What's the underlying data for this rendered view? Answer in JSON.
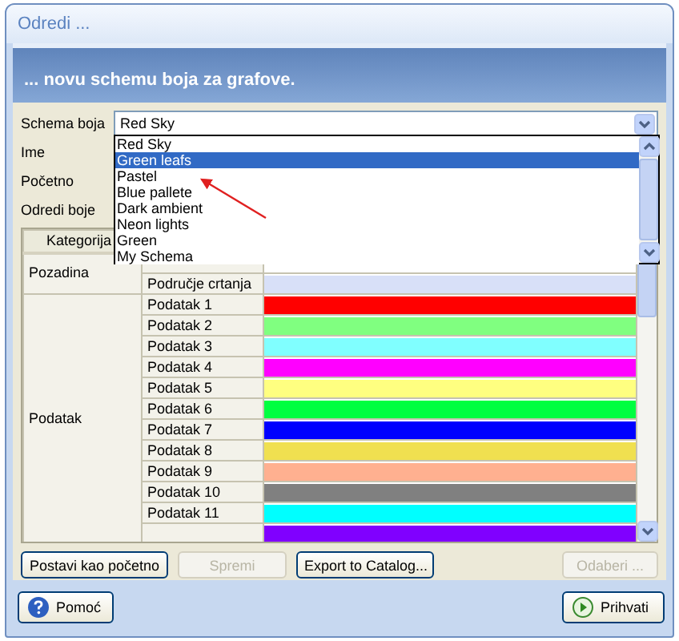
{
  "window": {
    "title": "Odredi ..."
  },
  "banner": {
    "text": "... novu schemu boja za grafove."
  },
  "scheme": {
    "label": "Schema boja",
    "value": "Red Sky"
  },
  "labels": [
    "Ime",
    "Početno",
    "Odredi boje"
  ],
  "dropdown": {
    "items": [
      {
        "label": "Red Sky",
        "selected": false
      },
      {
        "label": "Green leafs",
        "selected": true
      },
      {
        "label": "Pastel",
        "selected": false
      },
      {
        "label": "Blue pallete",
        "selected": false
      },
      {
        "label": "Dark ambient",
        "selected": false
      },
      {
        "label": "Neon lights",
        "selected": false
      },
      {
        "label": "Green",
        "selected": false
      },
      {
        "label": "My Schema",
        "selected": false
      }
    ]
  },
  "table": {
    "columns": [
      "Kategorija"
    ],
    "groups": [
      {
        "category": "Pozadina",
        "rows": [
          {
            "name": "Područje crtanja",
            "color": "#d8e0f8"
          }
        ]
      },
      {
        "category": "Podatak",
        "rows": [
          {
            "name": "Podatak 1",
            "color": "#ff0000"
          },
          {
            "name": "Podatak 2",
            "color": "#80ff80"
          },
          {
            "name": "Podatak 3",
            "color": "#80ffff"
          },
          {
            "name": "Podatak 4",
            "color": "#ff00ff"
          },
          {
            "name": "Podatak 5",
            "color": "#ffff80"
          },
          {
            "name": "Podatak 6",
            "color": "#00ff40"
          },
          {
            "name": "Podatak 7",
            "color": "#0000ff"
          },
          {
            "name": "Podatak 8",
            "color": "#f0e050"
          },
          {
            "name": "Podatak 9",
            "color": "#ffb090"
          },
          {
            "name": "Podatak 10",
            "color": "#808080"
          },
          {
            "name": "Podatak 11",
            "color": "#00ffff"
          },
          {
            "color": "#8000ff"
          }
        ]
      }
    ]
  },
  "buttons": [
    {
      "label": "Postavi kao početno",
      "disabled": false
    },
    {
      "label": "Spremi",
      "disabled": true
    },
    {
      "label": "Export to Catalog...",
      "disabled": false
    },
    {
      "label": "Odaberi ...",
      "disabled": true
    }
  ],
  "footer_buttons": [
    {
      "label": "Pomoć",
      "kind": "help"
    },
    {
      "label": "Prihvati",
      "kind": "accept"
    }
  ]
}
